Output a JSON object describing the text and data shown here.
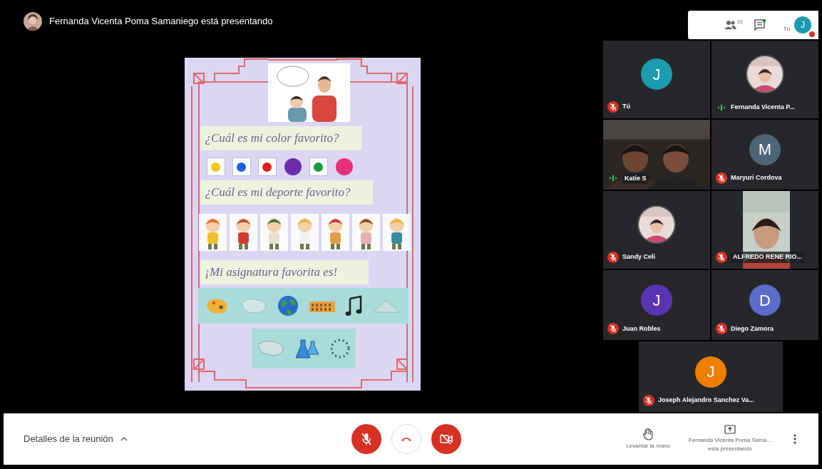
{
  "header": {
    "presenter_text": "Fernanda Vicenta Poma Samaniego está presentando"
  },
  "toolbar": {
    "participant_count": "10",
    "self_label": "Tú",
    "self_initial": "J",
    "alert": true
  },
  "slide": {
    "questions": [
      "¿Cuál es mi color favorito?",
      "¿Cuál es mi deporte favorito?",
      "¡Mi asignatura favorita es!"
    ],
    "swatches": [
      {
        "color": "#f5c518",
        "framed": true
      },
      {
        "color": "#1e5fe0",
        "framed": true
      },
      {
        "color": "#e01b1b",
        "framed": true
      },
      {
        "color": "#6a2fa8",
        "framed": false
      },
      {
        "color": "#1a9a3a",
        "framed": true
      },
      {
        "color": "#e8307a",
        "framed": false
      }
    ]
  },
  "participants": [
    {
      "name": "Tú",
      "kind": "letter",
      "initial": "J",
      "color": "#1a9bb0",
      "muted": true
    },
    {
      "name": "Fernanda Vicenta P...",
      "muted": false
    },
    {
      "name": "Katie S",
      "kind": "video",
      "muted": false
    },
    {
      "name": "Maryuri Cordova",
      "kind": "letter",
      "initial": "M",
      "color": "#4e6578",
      "muted": true
    },
    {
      "name": "Sandy Celi",
      "muted": true
    },
    {
      "name": "ALFREDO RENE RIO...",
      "kind": "portrait",
      "muted": true
    },
    {
      "name": "Juan Robles",
      "kind": "letter",
      "initial": "J",
      "color": "#5b34b3",
      "muted": true
    },
    {
      "name": "Diego Zamora",
      "kind": "letter",
      "initial": "D",
      "color": "#5a6bc8",
      "muted": true
    },
    {
      "name": "Joseph Alejandro Sanchez Va...",
      "kind": "letter",
      "initial": "J",
      "color": "#ef7d00",
      "muted": true
    }
  ],
  "controls": {
    "details_label": "Detalles de la reunión",
    "mic_on": false,
    "camera_on": false,
    "raise_hand_label": "Levantar la mano",
    "presenting_name": "Fernanda Vicenta Poma Sama...",
    "presenting_label": "está presentando"
  }
}
